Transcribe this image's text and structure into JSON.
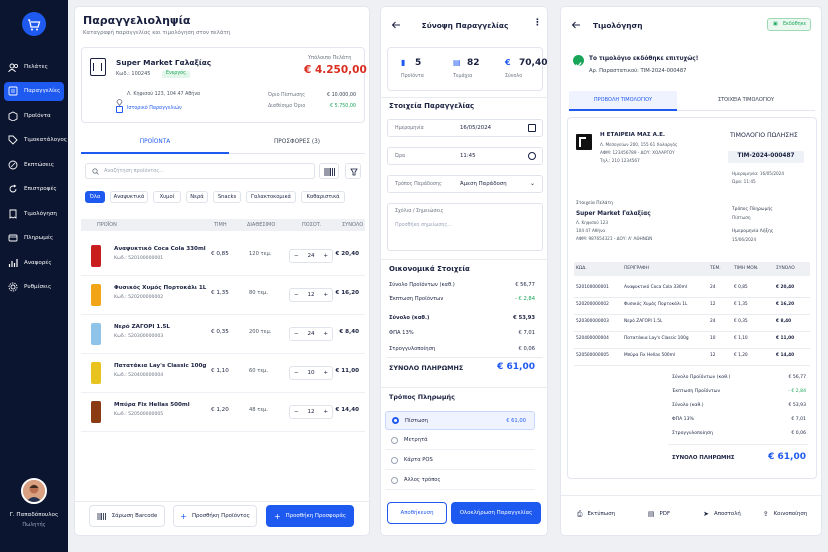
{
  "sidebar": {
    "items": [
      {
        "label": "Πελάτες",
        "icon": "users-icon"
      },
      {
        "label": "Παραγγελίες",
        "icon": "orders-icon",
        "active": true
      },
      {
        "label": "Προϊόντα",
        "icon": "box-icon"
      },
      {
        "label": "Τιμοκατάλογος",
        "icon": "tag-icon"
      },
      {
        "label": "Εκπτώσεις",
        "icon": "discount-icon"
      },
      {
        "label": "Επιστροφές",
        "icon": "return-icon"
      },
      {
        "label": "Τιμολόγηση",
        "icon": "invoice-icon"
      },
      {
        "label": "Πληρωμές",
        "icon": "payment-icon"
      },
      {
        "label": "Αναφορές",
        "icon": "chart-icon"
      },
      {
        "label": "Ρυθμίσεις",
        "icon": "gear-icon"
      }
    ],
    "user": {
      "name": "Γ. Παπαδόπουλος",
      "role": "Πωλητής"
    }
  },
  "orders": {
    "title": "Παραγγελιοληψία",
    "subtitle": "Καταγραφή παραγγελίας και τιμολόγηση στον πελάτη",
    "customer": {
      "name": "Super Market Γαλαξίας",
      "code": "Κωδ.: 100245",
      "status": "Ενεργός",
      "address": "Λ. Κηφισού 123, 104 47 Αθήνα",
      "history": "Ιστορικό Παραγγελιών",
      "balance_label": "Υπόλοιπο Πελάτη",
      "balance": "€ 4.250,00",
      "credit_label": "Όριο Πίστωσης",
      "credit": "€ 10.000,00",
      "available_label": "Διαθέσιμο Όριο",
      "available": "€ 5.750,00"
    },
    "tabs": [
      "ΠΡΟΪΟΝΤΑ",
      "ΠΡΟΣΦΟΡΕΣ (3)"
    ],
    "search_placeholder": "Αναζήτηση προϊόντος...",
    "categories": [
      "Όλα",
      "Αναψυκτικά",
      "Χυμοί",
      "Νερά",
      "Snacks",
      "Γαλακτοκομικά",
      "Καθαριστικά"
    ],
    "columns": [
      "ΠΡΟΪΟΝ",
      "ΤΙΜΗ",
      "ΔΙΑΘΕΣΙΜΟ",
      "ΠΟΣΟΤ.",
      "ΣΥΝΟΛΟ"
    ],
    "products": [
      {
        "name": "Αναψυκτικό Coca Cola 330ml",
        "code": "Κωδ.: 520100000001",
        "price": "€ 0,85",
        "stock": "120 τεμ.",
        "qty": "24",
        "total": "€ 20,40",
        "color": "#c81e1e"
      },
      {
        "name": "Φυσικός Χυμός Πορτοκάλι 1L",
        "code": "Κωδ.: 520200000002",
        "price": "€ 1,35",
        "stock": "80 τεμ.",
        "qty": "12",
        "total": "€ 16,20",
        "color": "#f2a516"
      },
      {
        "name": "Νερό ΖΑΓΟΡΙ 1.5L",
        "code": "Κωδ.: 520300000003",
        "price": "€ 0,35",
        "stock": "200 τεμ.",
        "qty": "24",
        "total": "€ 8,40",
        "color": "#8fc3ea"
      },
      {
        "name": "Πατατάκια Lay's Classic 100g",
        "code": "Κωδ.: 520400000004",
        "price": "€ 1,10",
        "stock": "60 τεμ.",
        "qty": "10",
        "total": "€ 11,00",
        "color": "#e8c320"
      },
      {
        "name": "Μπύρα Fix Hellas 500ml",
        "code": "Κωδ.: 520500000005",
        "price": "€ 1,20",
        "stock": "48 τεμ.",
        "qty": "12",
        "total": "€ 14,40",
        "color": "#8a3b12"
      }
    ],
    "buttons": {
      "scan": "Σάρωση Barcode",
      "add_product": "Προσθήκη Προϊόντος",
      "add_offer": "Προσθήκη Προσφοράς"
    }
  },
  "summary": {
    "title": "Σύνοψη Παραγγελίας",
    "stats": [
      {
        "value": "5",
        "label": "Προϊόντα"
      },
      {
        "value": "82",
        "label": "Τεμάχια"
      },
      {
        "value": "70,40",
        "label": "Σύνολο",
        "prefix": "€"
      }
    ],
    "details_title": "Στοιχεία Παραγγελίας",
    "date_label": "Ημερομηνία",
    "date": "16/05/2024",
    "time_label": "Ώρα",
    "time": "11:45",
    "delivery_label": "Τρόπος Παράδοσης",
    "delivery": "Άμεση Παράδοση",
    "notes_label": "Σχόλια / Σημειώσεις",
    "notes_placeholder": "Προσθήκη σημείωσης...",
    "fin_title": "Οικονομικά Στοιχεία",
    "fin": [
      {
        "label": "Σύνολο Προϊόντων (καθ.)",
        "value": "€ 56,77"
      },
      {
        "label": "Έκπτωση Προϊόντων",
        "value": "- € 2,84"
      },
      {
        "label": "Σύνολο (καθ.)",
        "value": "€ 53,93"
      },
      {
        "label": "ΦΠΑ 13%",
        "value": "€ 7,01"
      },
      {
        "label": "Στρογγυλοποίηση",
        "value": "€ 0,06"
      }
    ],
    "total_label": "ΣΥΝΟΛΟ ΠΛΗΡΩΜΗΣ",
    "total": "€ 61,00",
    "pay_title": "Τρόπος Πληρωμής",
    "payments": [
      {
        "label": "Πίστωση",
        "amount": "€ 61,00"
      },
      {
        "label": "Μετρητά"
      },
      {
        "label": "Κάρτα POS"
      },
      {
        "label": "Άλλος τρόπος"
      }
    ],
    "save": "Αποθήκευση",
    "complete": "Ολοκλήρωση Παραγγελίας"
  },
  "invoice": {
    "title": "Τιμολόγηση",
    "badge": "Εκδόθηκε",
    "success": "Το τιμολόγιο εκδόθηκε επιτυχώς!",
    "doc_no": "Αρ. Παραστατικού: ΤΙΜ-2024-000487",
    "tabs": [
      "ΠΡΟΒΟΛΗ ΤΙΜΟΛΟΓΙΟΥ",
      "ΣΤΟΙΧΕΙΑ ΤΙΜΟΛΟΓΙΟΥ"
    ],
    "company": {
      "name": "Η ΕΤΑΙΡΕΙΑ ΜΑΣ Α.Ε.",
      "addr": "Λ. Μεσογείων 200, 155 61 Χολαργός",
      "vat": "ΑΦΜ: 123456789 - ΔΟΥ: ΧΟΛΑΡΓΟΥ",
      "tel": "Τηλ.: 210 1234567"
    },
    "doc_title": "ΤΙΜΟΛΟΓΙΟ ΠΩΛΗΣΗΣ",
    "doc_code": "ΤΙΜ-2024-000487",
    "doc_date": "Ημερομηνία: 16/05/2024",
    "doc_time": "Ώρα: 11:45",
    "cust_label": "Στοιχεία Πελάτη",
    "cust_name": "Super Market Γαλαξίας",
    "cust_addr1": "Λ. Κηφισού 123",
    "cust_addr2": "104 47 Αθήνα",
    "cust_vat": "ΑΦΜ: 987654321 - ΔΟΥ: Α' ΑΘΗΝΩΝ",
    "pay_label": "Τρόπος Πληρωμής",
    "pay": "Πίστωση",
    "due_label": "Ημερομηνία Λήξης",
    "due": "15/06/2024",
    "columns": [
      "ΚΩΔ.",
      "ΠΕΡΙΓΡΑΦΗ",
      "ΤΕΜ.",
      "ΤΙΜΗ ΜΟΝ.",
      "ΣΥΝΟΛΟ"
    ],
    "rows": [
      [
        "520100000001",
        "Αναψυκτικό Coca Cola 330ml",
        "24",
        "€ 0,85",
        "€ 20,40"
      ],
      [
        "520200000002",
        "Φυσικός Χυμός Πορτοκάλι 1L",
        "12",
        "€ 1,35",
        "€ 16,20"
      ],
      [
        "520300000003",
        "Νερό ΖΑΓΟΡΙ 1.5L",
        "24",
        "€ 0,35",
        "€ 8,40"
      ],
      [
        "520400000004",
        "Πατατάκια Lay's Classic 100g",
        "10",
        "€ 1,10",
        "€ 11,00"
      ],
      [
        "520500000005",
        "Μπύρα Fix Hellas 500ml",
        "12",
        "€ 1,20",
        "€ 14,40"
      ]
    ],
    "totals": [
      {
        "label": "Σύνολο Προϊόντων (καθ.)",
        "value": "€ 56,77"
      },
      {
        "label": "Έκπτωση Προϊόντων",
        "value": "- € 2,84"
      },
      {
        "label": "Σύνολο (καθ.)",
        "value": "€ 53,93"
      },
      {
        "label": "ΦΠΑ 13%",
        "value": "€ 7,01"
      },
      {
        "label": "Στρογγυλοποίηση",
        "value": "€ 0,06"
      }
    ],
    "total_label": "ΣΥΝΟΛΟ ΠΛΗΡΩΜΗΣ",
    "total": "€ 61,00",
    "actions": [
      "Εκτύπωση",
      "PDF",
      "Αποστολή",
      "Κοινοποίηση"
    ]
  },
  "colors": {
    "accent": "#1f5af0",
    "sidebar": "#0b1530",
    "danger": "#d92d20",
    "success": "#18a558"
  }
}
